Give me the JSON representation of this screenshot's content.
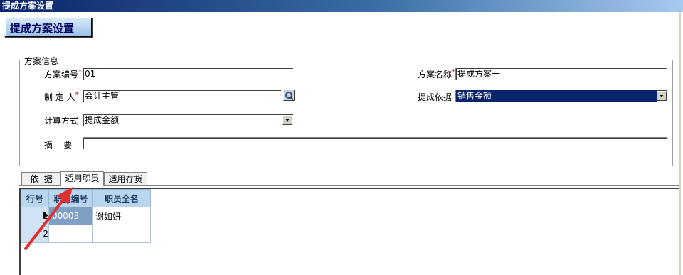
{
  "window": {
    "title": "提成方案设置"
  },
  "header": {
    "title": "提成方案设置"
  },
  "group": {
    "legend": "方案信息"
  },
  "form": {
    "scheme_no": {
      "label": "方案编号",
      "value": "01"
    },
    "scheme_name": {
      "label": "方案名称",
      "value": "提成方案一"
    },
    "creator": {
      "label": "制 定 人",
      "value": "会计主管"
    },
    "basis": {
      "label": "提成依据",
      "value": "销售金额"
    },
    "calc_method": {
      "label": "计算方式",
      "value": "提成金额"
    },
    "summary": {
      "label": "摘    要",
      "value": ""
    },
    "required_mark": "*"
  },
  "tabs": [
    {
      "label": "依  据",
      "active": false
    },
    {
      "label": "适用职员",
      "active": true
    },
    {
      "label": "适用存货",
      "active": false
    }
  ],
  "grid": {
    "headers": [
      "行号",
      "职员编号",
      "职员全名"
    ],
    "rows": [
      {
        "num": "1",
        "code": "00003",
        "name": "谢如妍"
      },
      {
        "num": "2",
        "code": "",
        "name": ""
      }
    ]
  },
  "colors": {
    "annotation_arrow": "#e03030",
    "selection": "#0a246a"
  }
}
